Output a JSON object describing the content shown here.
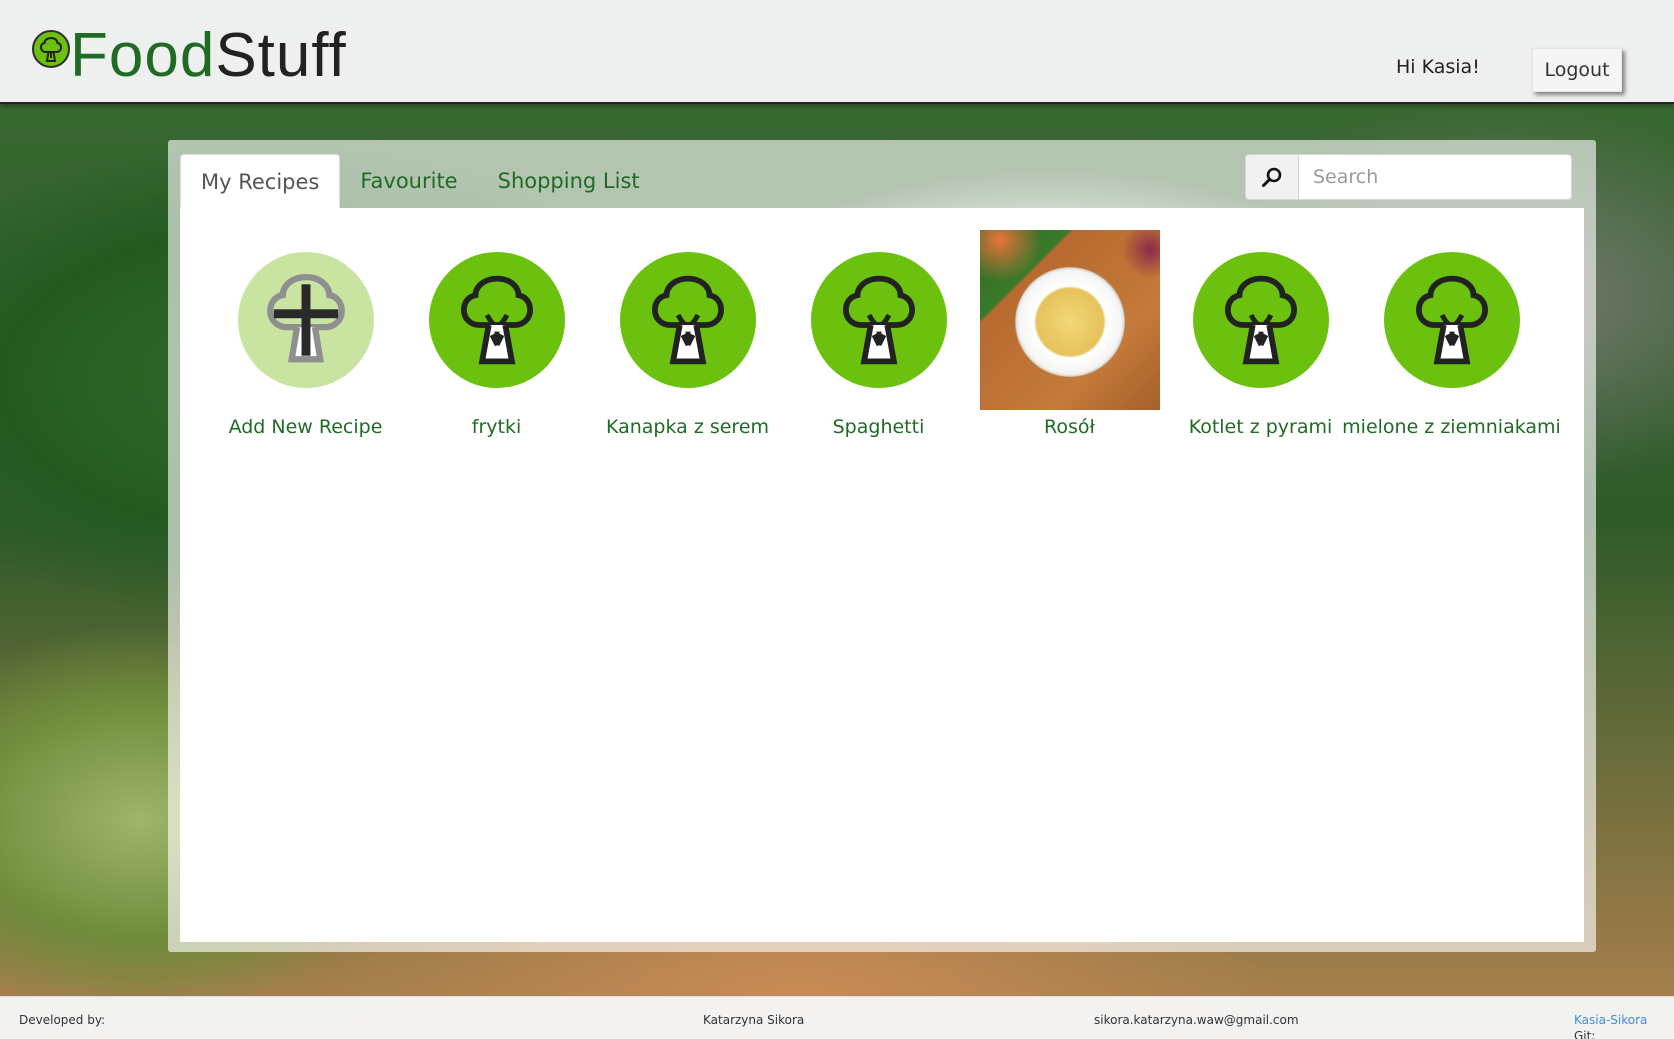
{
  "header": {
    "logo_food": "Food",
    "logo_stuff": "Stuff",
    "greeting": "Hi Kasia!",
    "logout_label": "Logout"
  },
  "tabs": [
    {
      "label": "My Recipes",
      "active": true
    },
    {
      "label": "Favourite",
      "active": false
    },
    {
      "label": "Shopping List",
      "active": false
    }
  ],
  "search": {
    "placeholder": "Search",
    "value": ""
  },
  "recipes": [
    {
      "label": "Add New Recipe",
      "icon": "add-recipe-icon"
    },
    {
      "label": "frytki",
      "icon": "broccoli-icon"
    },
    {
      "label": "Kanapka z serem",
      "icon": "broccoli-icon"
    },
    {
      "label": "Spaghetti",
      "icon": "broccoli-icon"
    },
    {
      "label": "Rosół",
      "icon": "photo"
    },
    {
      "label": "Kotlet z pyrami",
      "icon": "broccoli-icon"
    },
    {
      "label": "mielone z ziemniakami",
      "icon": "broccoli-icon"
    }
  ],
  "footer": {
    "developed_by": "Developed by:",
    "author": "Katarzyna Sikora",
    "email": "sikora.katarzyna.waw@gmail.com",
    "git_label": "Git:",
    "git_link": "Kasia-Sikora"
  },
  "colors": {
    "brand_green": "#6cc10f",
    "text_green": "#1f6b25",
    "link_blue": "#3b8fd6"
  }
}
